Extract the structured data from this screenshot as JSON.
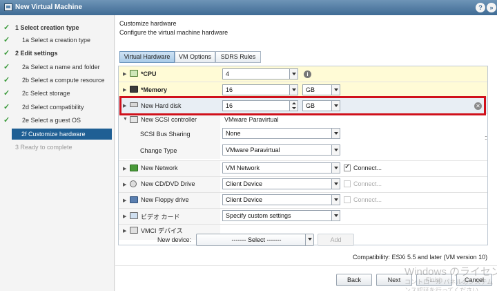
{
  "window": {
    "title": "New Virtual Machine",
    "help_label": "?",
    "collapse_label": "»"
  },
  "nav": [
    {
      "label": "1  Select creation type",
      "state": "done-head"
    },
    {
      "label": "1a  Select a creation type",
      "state": "done"
    },
    {
      "label": "2  Edit settings",
      "state": "done-head"
    },
    {
      "label": "2a  Select a name and folder",
      "state": "done"
    },
    {
      "label": "2b  Select a compute resource",
      "state": "done"
    },
    {
      "label": "2c  Select storage",
      "state": "done"
    },
    {
      "label": "2d  Select compatibility",
      "state": "done"
    },
    {
      "label": "2e  Select a guest OS",
      "state": "done"
    },
    {
      "label": "2f  Customize hardware",
      "state": "active"
    },
    {
      "label": "3  Ready to complete",
      "state": "disabled"
    }
  ],
  "page": {
    "title": "Customize hardware",
    "subtitle": "Configure the virtual machine hardware"
  },
  "tabs": [
    "Virtual Hardware",
    "VM Options",
    "SDRS Rules"
  ],
  "hardware": {
    "cpu": {
      "label": "*CPU",
      "value": "4"
    },
    "memory": {
      "label": "*Memory",
      "value": "16",
      "unit": "GB"
    },
    "hard_disk": {
      "label": "New Hard disk",
      "value": "16",
      "unit": "GB"
    },
    "scsi": {
      "label": "New SCSI controller",
      "value": "VMware Paravirtual",
      "bus_sharing_label": "SCSI Bus Sharing",
      "bus_sharing_value": "None",
      "change_type_label": "Change Type",
      "change_type_value": "VMware Paravirtual"
    },
    "network": {
      "label": "New Network",
      "value": "VM Network",
      "connect_label": "Connect..."
    },
    "cddvd": {
      "label": "New CD/DVD Drive",
      "value": "Client Device",
      "connect_label": "Connect..."
    },
    "floppy": {
      "label": "New Floppy drive",
      "value": "Client Device",
      "connect_label": "Connect..."
    },
    "video": {
      "label": "ビデオ カード",
      "value": "Specify custom settings"
    },
    "vmci": {
      "label": "VMCI デバイス"
    }
  },
  "new_device": {
    "label": "New device:",
    "value": "------- Select -------",
    "add_label": "Add"
  },
  "compatibility": "Compatibility: ESXi 5.5 and later (VM version 10)",
  "buttons": {
    "back": "Back",
    "next": "Next",
    "finish": "Finish",
    "cancel": "Cancel"
  },
  "watermark": {
    "line1": "Windows のライセンス",
    "line2": "コントロール パネルのシステム",
    "line3": "ンス認証を行ってください。"
  }
}
